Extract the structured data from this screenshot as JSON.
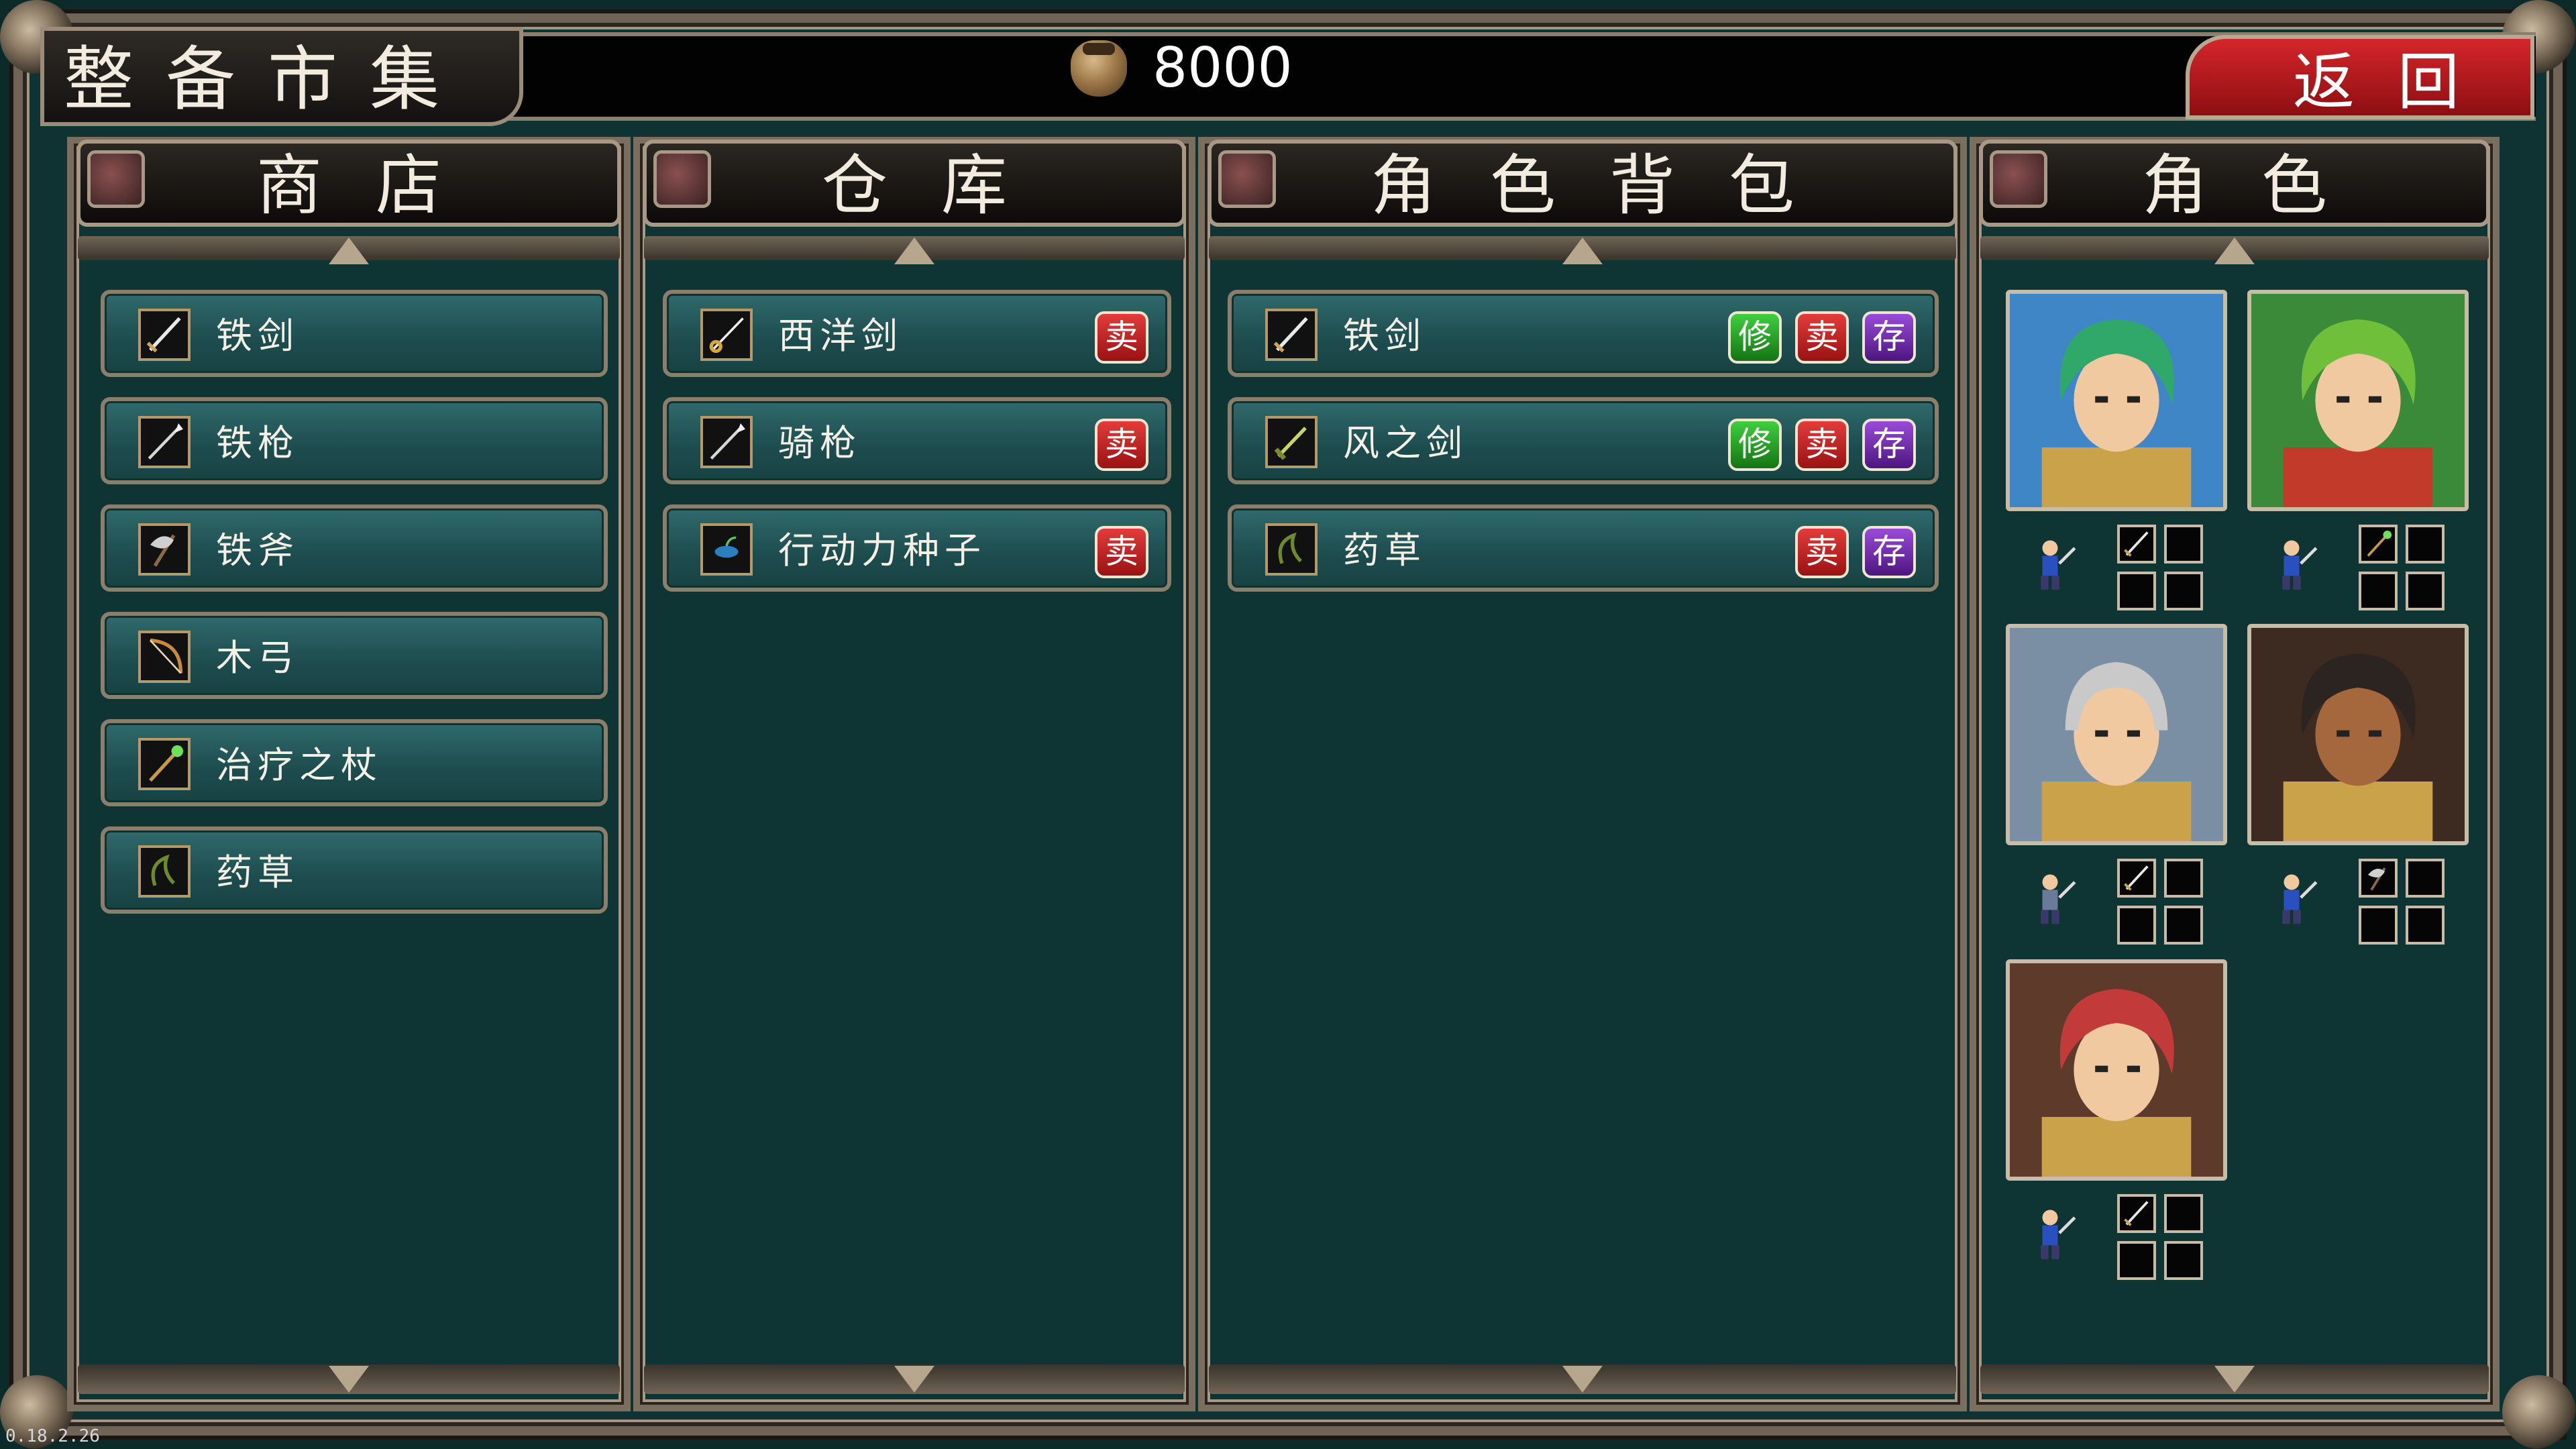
{
  "screen": {
    "title": "整备市集",
    "gold": "8000",
    "back_label": "返回",
    "version": "0.18.2.26"
  },
  "colors": {
    "background": "#0f3434",
    "item_row": "#1d4c4e",
    "sell_button": "#c51f1f",
    "repair_button": "#22a322",
    "store_button": "#6a2aa8",
    "back_button": "#b5181c"
  },
  "panels": {
    "shop": {
      "title": "商店",
      "items": [
        {
          "name": "铁剑",
          "icon": "sword-icon"
        },
        {
          "name": "铁枪",
          "icon": "lance-icon"
        },
        {
          "name": "铁斧",
          "icon": "axe-icon"
        },
        {
          "name": "木弓",
          "icon": "bow-icon"
        },
        {
          "name": "治疗之杖",
          "icon": "staff-icon"
        },
        {
          "name": "药草",
          "icon": "herb-icon"
        }
      ]
    },
    "storage": {
      "title": "仓库",
      "items": [
        {
          "name": "西洋剑",
          "icon": "rapier-icon",
          "sell": "卖"
        },
        {
          "name": "骑枪",
          "icon": "lance-icon",
          "sell": "卖"
        },
        {
          "name": "行动力种子",
          "icon": "seed-icon",
          "sell": "卖"
        }
      ]
    },
    "bag": {
      "title": "角色背包",
      "items": [
        {
          "name": "铁剑",
          "icon": "sword-icon",
          "repair": "修",
          "sell": "卖",
          "store": "存"
        },
        {
          "name": "风之剑",
          "icon": "wind-sword-icon",
          "repair": "修",
          "sell": "卖",
          "store": "存"
        },
        {
          "name": "药草",
          "icon": "herb-icon",
          "sell": "卖",
          "store": "存"
        }
      ]
    },
    "characters": {
      "title": "角色",
      "list": [
        {
          "id": "green-haired-swordsman",
          "hair": "#2fa86a",
          "slot_icons": [
            "sword-icon"
          ]
        },
        {
          "id": "green-haired-cleric",
          "hair": "#6fbf3a",
          "slot_icons": [
            "staff-icon"
          ]
        },
        {
          "id": "armored-knight",
          "hair": "#c9c9c9",
          "slot_icons": [
            "sword-icon"
          ]
        },
        {
          "id": "axe-fighter",
          "hair": "#2b2420",
          "slot_icons": [
            "axe-icon"
          ]
        },
        {
          "id": "red-haired-cavalier",
          "hair": "#c23a3a",
          "slot_icons": [
            "sword-icon"
          ]
        }
      ]
    }
  }
}
